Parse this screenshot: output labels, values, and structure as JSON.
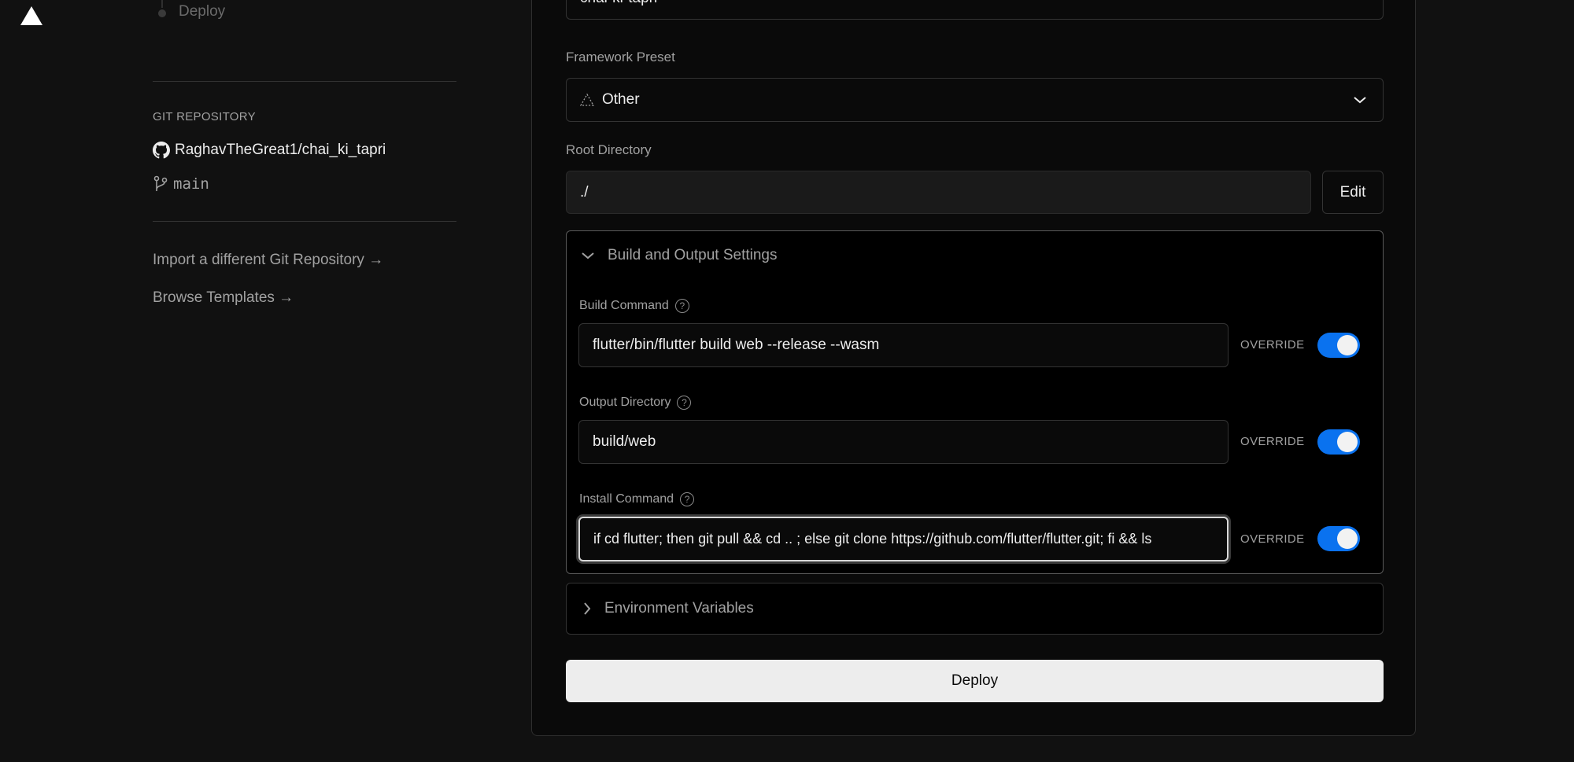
{
  "nav": {
    "logo_icon": "vercel-triangle-icon"
  },
  "steps": {
    "deploy_label": "Deploy"
  },
  "sidebar": {
    "git_heading": "GIT REPOSITORY",
    "repo_name": "RaghavTheGreat1/chai_ki_tapri",
    "repo_icon": "github-icon",
    "branch": "main",
    "branch_icon": "git-branch-icon",
    "import_link": "Import a different Git Repository →",
    "templates_link": "Browse Templates →"
  },
  "form": {
    "project_name_value": "chai-ki-tapri",
    "framework": {
      "label": "Framework Preset",
      "value": "Other",
      "icon": "triangle-outline-icon"
    },
    "root_directory": {
      "label": "Root Directory",
      "value": "./",
      "edit_label": "Edit"
    },
    "build_settings": {
      "title": "Build and Output Settings",
      "expanded": true,
      "override_label": "OVERRIDE",
      "fields": [
        {
          "label": "Build Command",
          "value": "flutter/bin/flutter build web --release --wasm",
          "override": true
        },
        {
          "label": "Output Directory",
          "value": "build/web",
          "override": true
        },
        {
          "label": "Install Command",
          "value": "if cd flutter; then git pull && cd .. ; else git clone https://github.com/flutter/flutter.git; fi && ls",
          "override": true
        }
      ]
    },
    "env_vars": {
      "title": "Environment Variables",
      "expanded": false
    },
    "deploy_label": "Deploy"
  },
  "colors": {
    "accent": "#0a72ef",
    "background": "#111111",
    "panel": "#000000",
    "button_bg": "#ededed"
  }
}
